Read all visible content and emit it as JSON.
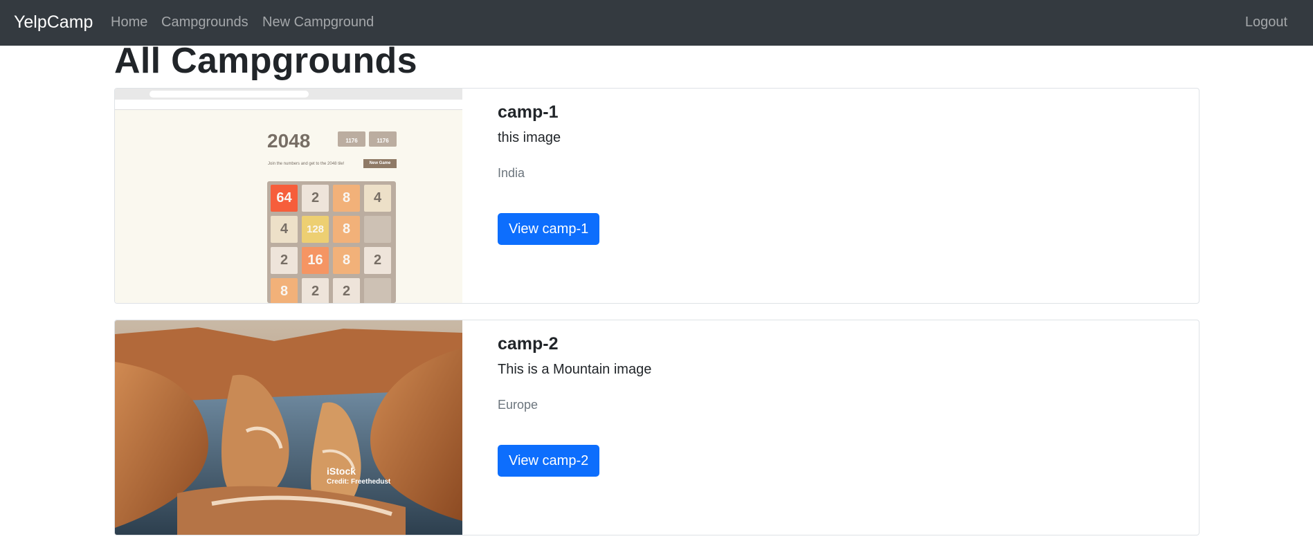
{
  "navbar": {
    "brand": "YelpCamp",
    "links": [
      "Home",
      "Campgrounds",
      "New Campground"
    ],
    "logout": "Logout"
  },
  "page": {
    "title": "All Campgrounds"
  },
  "campgrounds": [
    {
      "title": "camp-1",
      "description": "this image",
      "location": "India",
      "button": "View camp-1",
      "thumbnail": {
        "game_title": "2048",
        "score_label": "SCORE",
        "score": "1176",
        "best_label": "BEST",
        "best": "1176",
        "subtitle": "Join the numbers and get to the 2048 tile!",
        "new_game": "New Game",
        "tiles": [
          "64",
          "2",
          "8",
          "4",
          "4",
          "128",
          "8",
          "",
          "2",
          "16",
          "8",
          "2",
          "8",
          "2",
          "2",
          ""
        ]
      }
    },
    {
      "title": "camp-2",
      "description": "This is a Mountain image",
      "location": "Europe",
      "button": "View camp-2",
      "thumbnail": {
        "watermark": "iStock",
        "credit": "Credit: Freethedust"
      }
    }
  ],
  "colors": {
    "navbar": "#343a40",
    "primary": "#0d6efd",
    "muted": "#6c757d"
  }
}
